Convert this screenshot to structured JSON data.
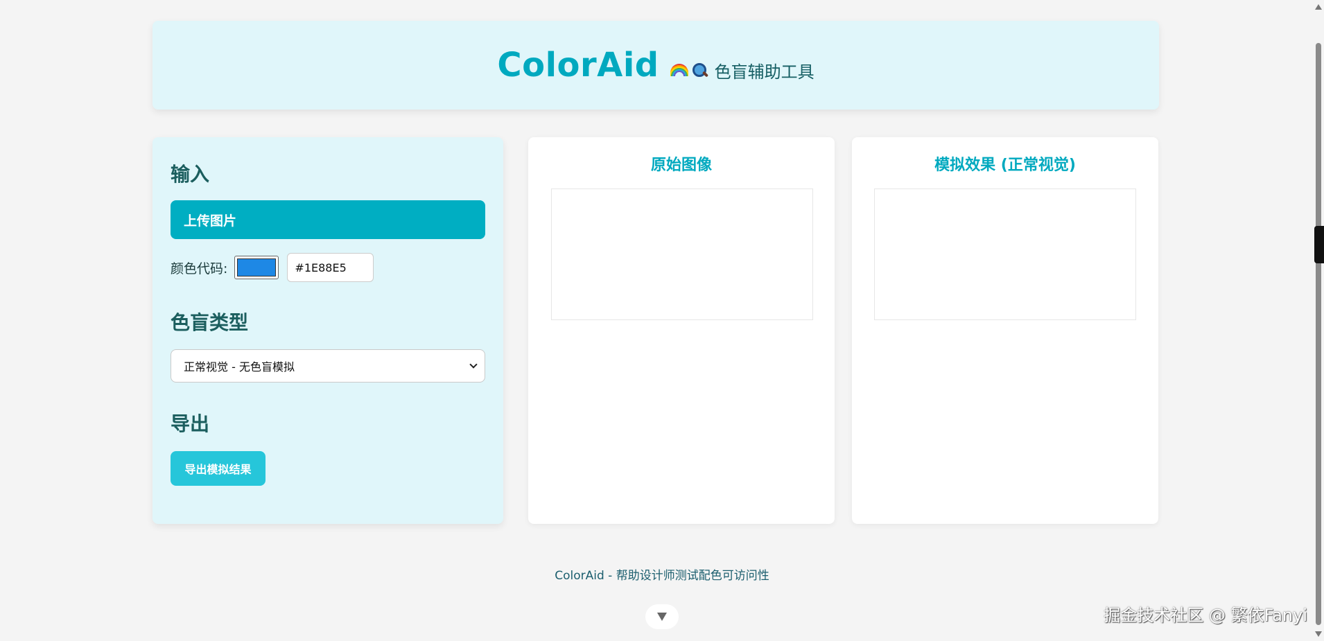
{
  "header": {
    "app_title": "ColorAid",
    "subtitle": "色盲辅助工具"
  },
  "panel": {
    "input_title": "输入",
    "upload_label": "上传图片",
    "color_label": "颜色代码:",
    "color_value": "#1E88E5",
    "type_title": "色盲类型",
    "type_selected": "正常视觉 - 无色盲模拟",
    "export_title": "导出",
    "export_label": "导出模拟结果"
  },
  "cards": {
    "original_title": "原始图像",
    "simulated_title": "模拟效果 (正常视觉)"
  },
  "footer": {
    "text": "ColorAid - 帮助设计师测试配色可访问性"
  },
  "watermark": "掘金技术社区 @ 繁依Fanyi",
  "colors": {
    "accent": "#00aec2",
    "panel_bg": "#e0f6fa",
    "selected_color": "#1E88E5"
  }
}
